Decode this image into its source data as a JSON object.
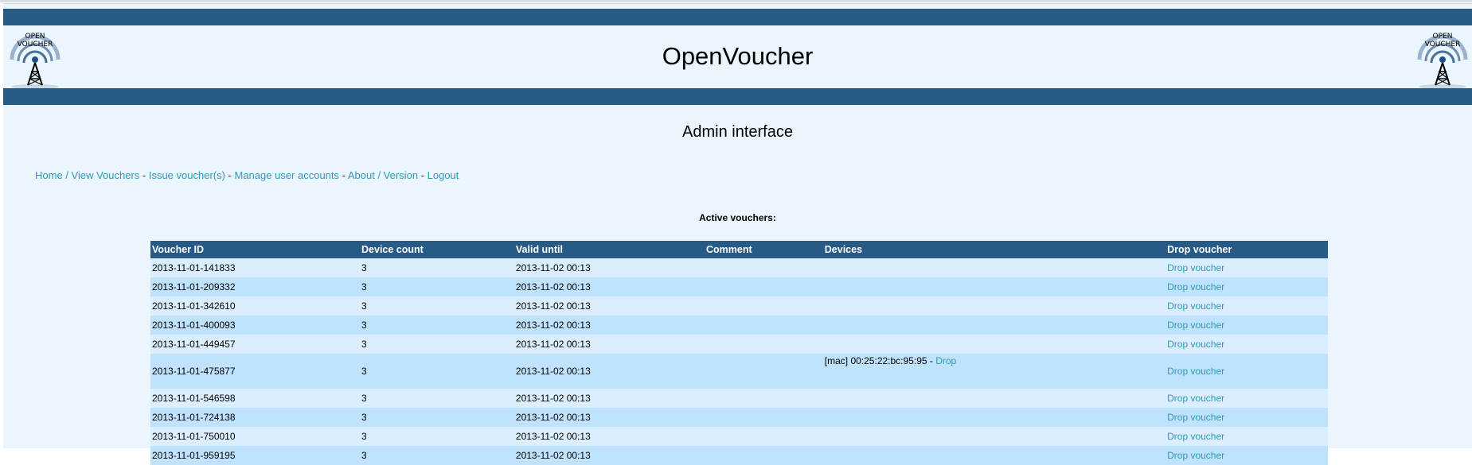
{
  "app": {
    "title": "OpenVoucher",
    "logo_line1": "OPEN",
    "logo_line2": "VOUCHER"
  },
  "subtitle": "Admin interface",
  "nav": {
    "items": [
      {
        "label": "Home / View Vouchers"
      },
      {
        "label": "Issue voucher(s)"
      },
      {
        "label": "Manage user accounts"
      },
      {
        "label": "About / Version"
      },
      {
        "label": "Logout"
      }
    ],
    "separator": " - "
  },
  "section_heading": "Active vouchers:",
  "table": {
    "headers": {
      "id": "Voucher ID",
      "count": "Device count",
      "valid": "Valid until",
      "comment": "Comment",
      "devices": "Devices",
      "drop": "Drop voucher"
    },
    "drop_label": "Drop voucher",
    "device_drop_label": "Drop",
    "rows": [
      {
        "id": "2013-11-01-141833",
        "count": "3",
        "valid": "2013-11-02 00:13",
        "comment": "",
        "device": ""
      },
      {
        "id": "2013-11-01-209332",
        "count": "3",
        "valid": "2013-11-02 00:13",
        "comment": "",
        "device": ""
      },
      {
        "id": "2013-11-01-342610",
        "count": "3",
        "valid": "2013-11-02 00:13",
        "comment": "",
        "device": ""
      },
      {
        "id": "2013-11-01-400093",
        "count": "3",
        "valid": "2013-11-02 00:13",
        "comment": "",
        "device": ""
      },
      {
        "id": "2013-11-01-449457",
        "count": "3",
        "valid": "2013-11-02 00:13",
        "comment": "",
        "device": ""
      },
      {
        "id": "2013-11-01-475877",
        "count": "3",
        "valid": "2013-11-02 00:13",
        "comment": "",
        "device": "[mac] 00:25:22:bc:95:95"
      },
      {
        "id": "2013-11-01-546598",
        "count": "3",
        "valid": "2013-11-02 00:13",
        "comment": "",
        "device": ""
      },
      {
        "id": "2013-11-01-724138",
        "count": "3",
        "valid": "2013-11-02 00:13",
        "comment": "",
        "device": ""
      },
      {
        "id": "2013-11-01-750010",
        "count": "3",
        "valid": "2013-11-02 00:13",
        "comment": "",
        "device": ""
      },
      {
        "id": "2013-11-01-959195",
        "count": "3",
        "valid": "2013-11-02 00:13",
        "comment": "",
        "device": ""
      }
    ]
  },
  "colors": {
    "bar": "#275a84",
    "background": "#eaf5fe",
    "link": "#2f9ab8",
    "row_light": "#daeefd",
    "row_dark": "#bfe2fd"
  }
}
